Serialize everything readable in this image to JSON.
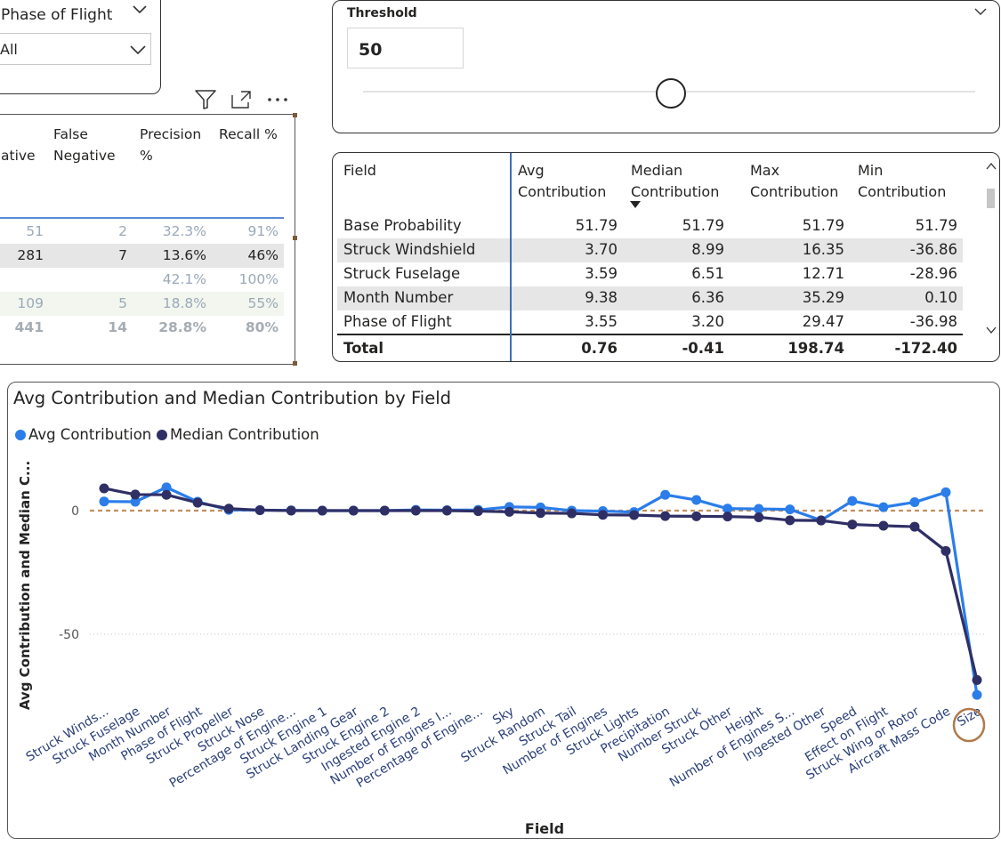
{
  "slicer": {
    "title": "Phase of Flight",
    "selected": "All"
  },
  "threshold": {
    "title": "Threshold",
    "value": "50",
    "slider_fraction": 0.5
  },
  "visual_header": {
    "icons": [
      "filter-icon",
      "focus-mode-icon",
      "more-options-icon"
    ]
  },
  "matrix": {
    "columns": [
      "False\nNegative",
      "Precision\n%",
      "Recall %"
    ],
    "partial_column": "ative",
    "rows": [
      {
        "c0": "51",
        "c1": "2",
        "c2": "32.3%",
        "c3": "91%",
        "style": "faded"
      },
      {
        "c0": "281",
        "c1": "7",
        "c2": "13.6%",
        "c3": "46%",
        "style": "shade"
      },
      {
        "c0": "",
        "c1": "",
        "c2": "42.1%",
        "c3": "100%",
        "style": "faded"
      },
      {
        "c0": "109",
        "c1": "5",
        "c2": "18.8%",
        "c3": "55%",
        "style": "faded light"
      },
      {
        "c0": "441",
        "c1": "14",
        "c2": "28.8%",
        "c3": "80%",
        "style": "bold"
      }
    ]
  },
  "contrib_table": {
    "columns": [
      "Field",
      "Avg\nContribution",
      "Median\nContribution",
      "Max\nContribution",
      "Min\nContribution"
    ],
    "sorted_column": "Median Contribution",
    "rows": [
      {
        "field": "Base Probability",
        "avg": "51.79",
        "median": "51.79",
        "max": "51.79",
        "min": "51.79"
      },
      {
        "field": "Struck Windshield",
        "avg": "3.70",
        "median": "8.99",
        "max": "16.35",
        "min": "-36.86"
      },
      {
        "field": "Struck Fuselage",
        "avg": "3.59",
        "median": "6.51",
        "max": "12.71",
        "min": "-28.96"
      },
      {
        "field": "Month Number",
        "avg": "9.38",
        "median": "6.36",
        "max": "35.29",
        "min": "0.10"
      },
      {
        "field": "Phase of Flight",
        "avg": "3.55",
        "median": "3.20",
        "max": "29.47",
        "min": "-36.98"
      }
    ],
    "total": {
      "label": "Total",
      "avg": "0.76",
      "median": "-0.41",
      "max": "198.74",
      "min": "-172.40"
    }
  },
  "colors": {
    "avg": "#2b7de9",
    "median": "#2f2f66",
    "reference": "#c09060",
    "highlight": "#b07a4a"
  },
  "chart_data": {
    "type": "line",
    "title": "Avg Contribution and Median Contribution by Field",
    "xlabel": "Field",
    "ylabel": "Avg Contribution and Median C...",
    "ylim": [
      -75,
      13
    ],
    "yticks": [
      0,
      -50
    ],
    "legend_position": "top-left",
    "reference_line": 0,
    "highlighted_category": "Size",
    "categories": [
      "Struck Winds...",
      "Struck Fuselage",
      "Month Number",
      "Phase of Flight",
      "Struck Propeller",
      "Struck Nose",
      "Percentage of Engine...",
      "Struck Engine 1",
      "Struck Landing Gear",
      "Struck Engine 2",
      "Ingested Engine 2",
      "Number of Engines I...",
      "Percentage of Engine...",
      "Sky",
      "Struck Random",
      "Struck Tail",
      "Number of Engines",
      "Struck Lights",
      "Precipitation",
      "Number Struck",
      "Struck Other",
      "Height",
      "Number of Engines S...",
      "Ingested Other",
      "Speed",
      "Effect on Flight",
      "Struck Wing or Rotor",
      "Aircraft Mass Code",
      "Size"
    ],
    "series": [
      {
        "name": "Avg Contribution",
        "values": [
          3.7,
          3.6,
          9.4,
          3.6,
          0.3,
          0.2,
          0.1,
          0,
          0,
          0,
          0.3,
          0.2,
          0.3,
          1.5,
          1.3,
          0,
          -0.2,
          -0.6,
          6.4,
          4.3,
          0.8,
          0.7,
          0.5,
          -3.9,
          3.9,
          1.4,
          3.4,
          7.4,
          -74.5
        ]
      },
      {
        "name": "Median Contribution",
        "values": [
          9.0,
          6.5,
          6.4,
          3.2,
          0.8,
          0.2,
          0,
          0,
          0,
          0,
          0,
          0,
          -0.2,
          -0.5,
          -1.0,
          -1.1,
          -1.7,
          -1.8,
          -2.2,
          -2.3,
          -2.4,
          -2.7,
          -3.9,
          -4.0,
          -5.6,
          -6.1,
          -6.5,
          -16.3,
          -68.5
        ]
      }
    ]
  }
}
